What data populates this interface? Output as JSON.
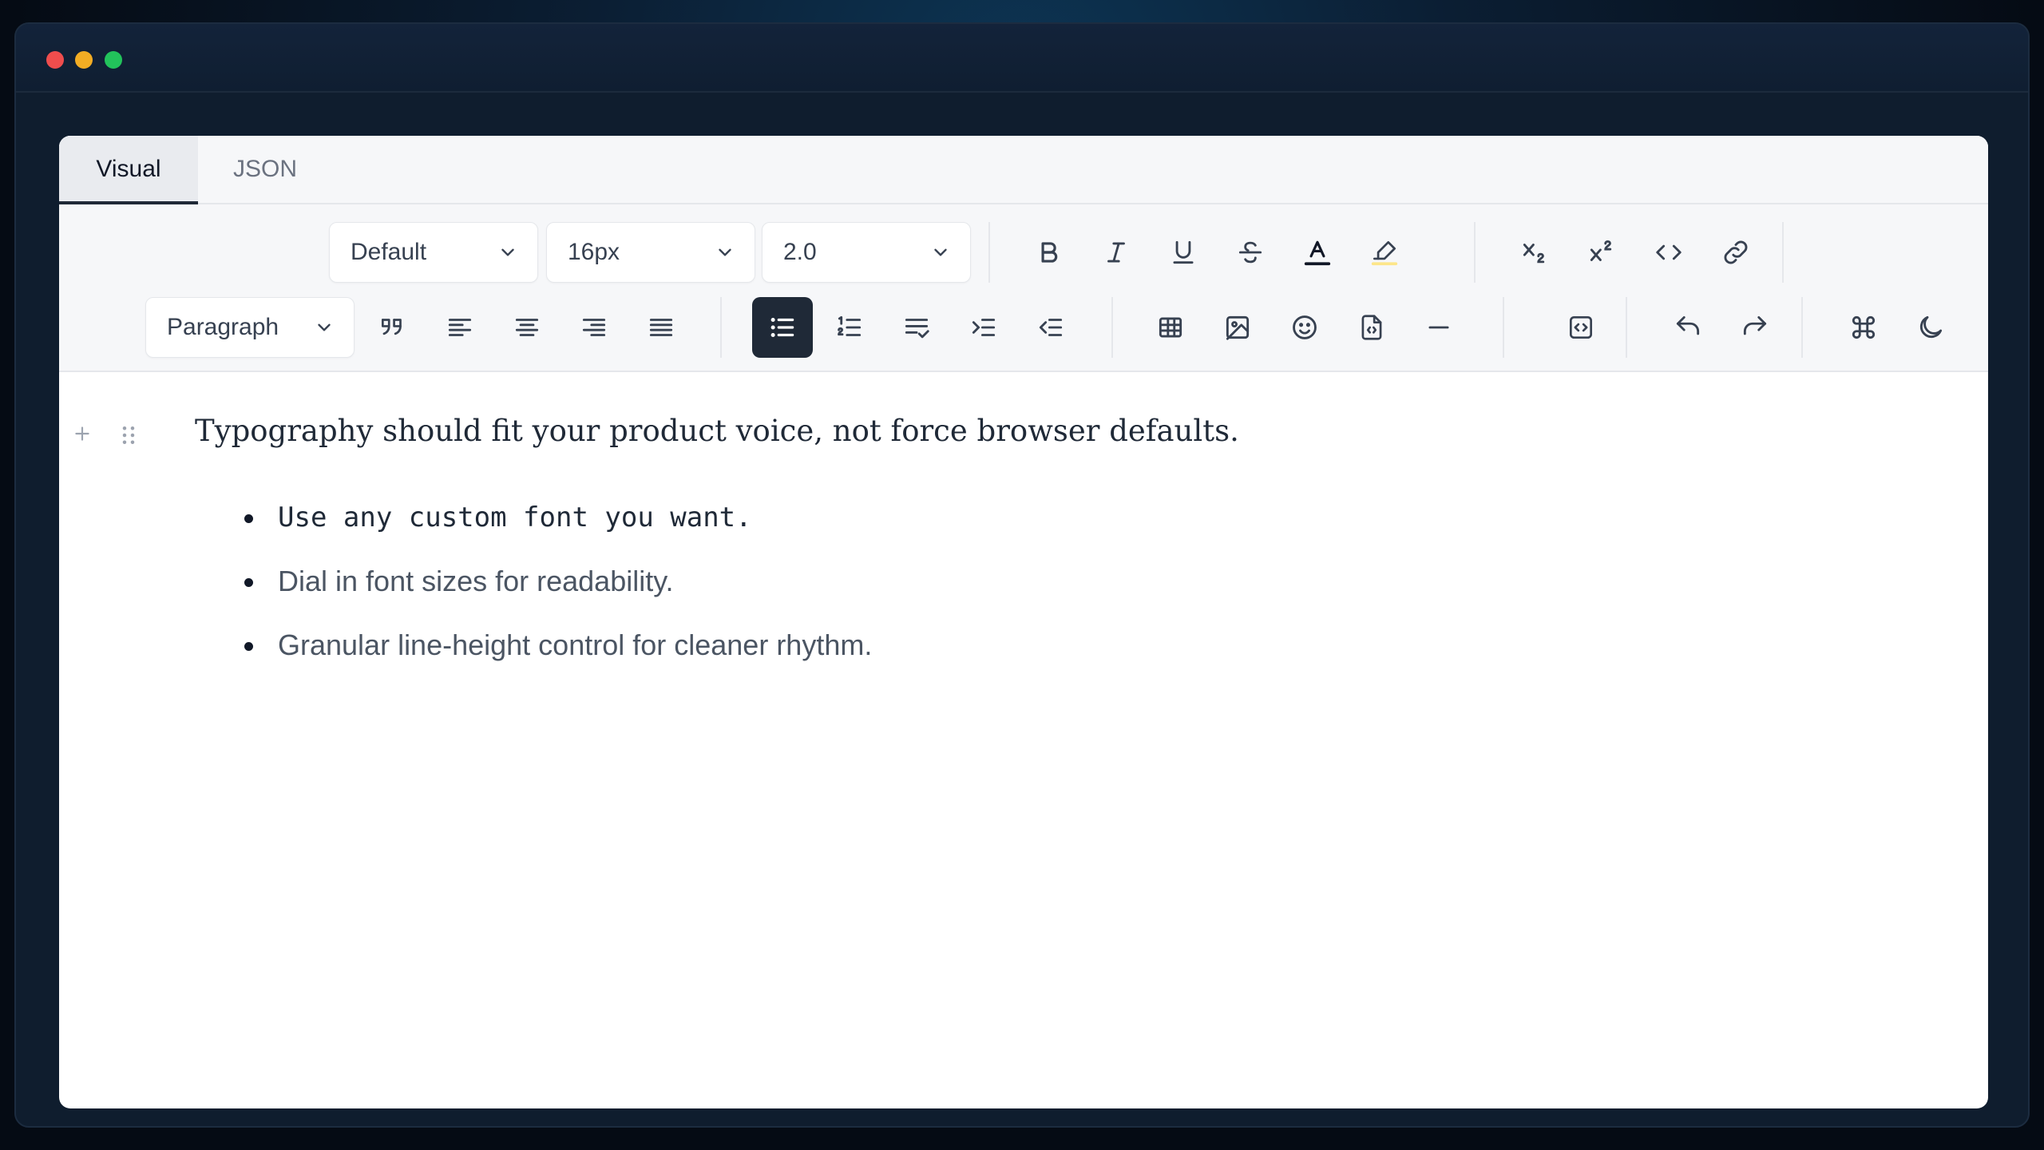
{
  "window": {
    "buttons": [
      "close",
      "minimize",
      "maximize"
    ]
  },
  "tabs": [
    {
      "label": "Visual",
      "active": true
    },
    {
      "label": "JSON",
      "active": false
    }
  ],
  "toolbar": {
    "font_family": "Default",
    "font_size": "16px",
    "line_height": "2.0",
    "block_type": "Paragraph",
    "row1_icons": [
      "bold-icon",
      "italic-icon",
      "underline-icon",
      "strikethrough-icon",
      "text-color-icon",
      "highlight-icon",
      "subscript-icon",
      "superscript-icon",
      "code-icon",
      "link-icon"
    ],
    "row2_icons": [
      "blockquote-icon",
      "align-left-icon",
      "align-center-icon",
      "align-right-icon",
      "align-justify-icon",
      "bullet-list-icon",
      "ordered-list-icon",
      "task-list-icon",
      "indent-icon",
      "outdent-icon",
      "table-icon",
      "image-icon",
      "emoji-icon",
      "file-icon",
      "horizontal-rule-icon",
      "embed-icon",
      "undo-icon",
      "redo-icon",
      "command-icon",
      "dark-mode-icon"
    ],
    "active_button": "bullet-list-icon"
  },
  "content": {
    "paragraph": "Typography should fit your product voice, not force browser defaults.",
    "bullets": [
      "Use any custom font you want.",
      "Dial in font sizes for readability.",
      "Granular line-height control for cleaner rhythm."
    ]
  },
  "colors": {
    "active_button_bg": "#1f2937",
    "window_bg": "#0f1d2e",
    "highlight_underline": "#fde68a"
  }
}
